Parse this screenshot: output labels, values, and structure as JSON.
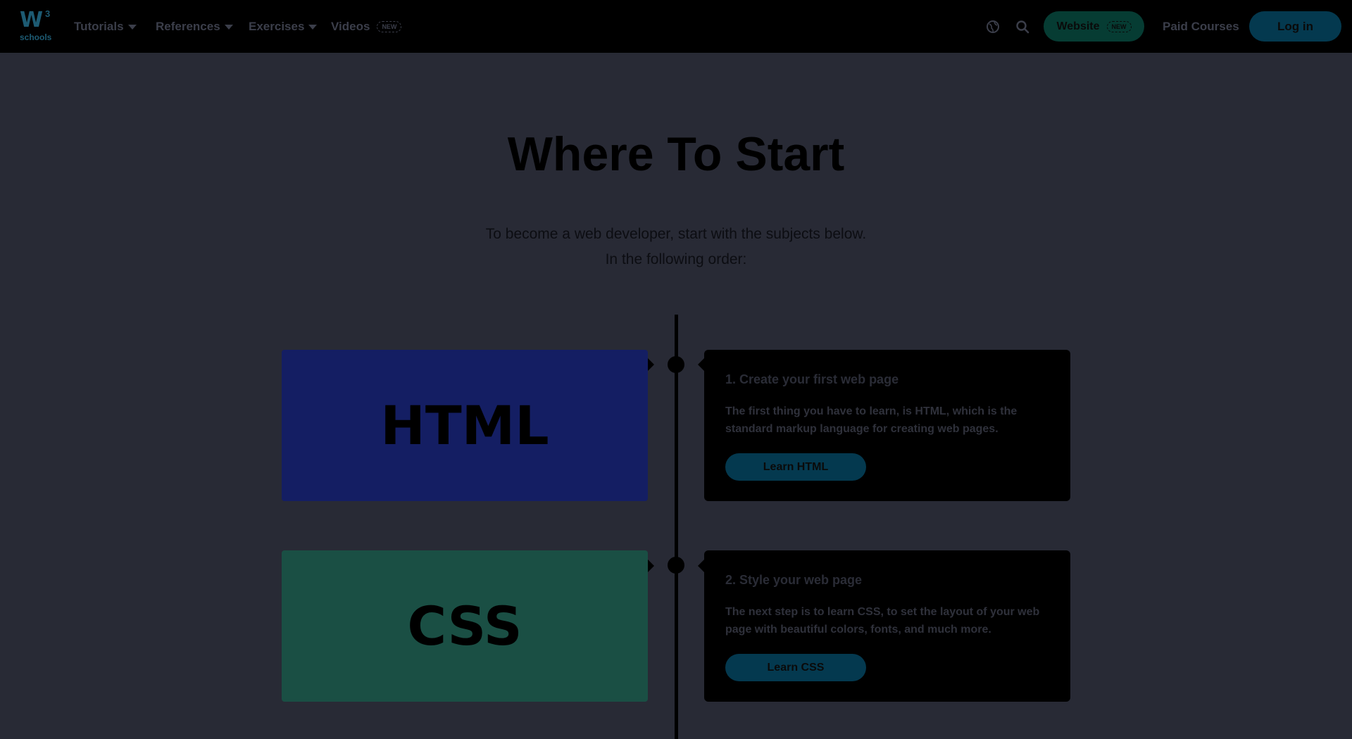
{
  "brand": {
    "logo_main": "W",
    "logo_sup": "3",
    "logo_sub": "schools"
  },
  "nav": {
    "tutorials": "Tutorials",
    "references": "References",
    "exercises": "Exercises",
    "videos": "Videos",
    "videos_badge": "NEW",
    "website": "Website",
    "website_badge": "NEW",
    "paid_courses": "Paid Courses",
    "login": "Log in"
  },
  "hero": {
    "title": "Where To Start",
    "subtitle_line1": "To become a web developer, start with the subjects below.",
    "subtitle_line2": "In the following order:"
  },
  "steps": [
    {
      "tile_label": "HTML",
      "tile_color": "#141e63",
      "title": "1. Create your first web page",
      "text": "The first thing you have to learn, is HTML, which is the standard markup language for creating web pages.",
      "button": "Learn HTML"
    },
    {
      "tile_label": "CSS",
      "tile_color": "#1a4f44",
      "title": "2. Style your web page",
      "text": "The next step is to learn CSS, to set the layout of your web page with beautiful colors, fonts, and much more.",
      "button": "Learn CSS"
    }
  ],
  "colors": {
    "background": "#282a35",
    "navbar": "#000000",
    "accent_button": "#04394f",
    "website_button": "#063c33"
  },
  "icons": {
    "globe": "globe-icon",
    "search": "search-icon"
  }
}
